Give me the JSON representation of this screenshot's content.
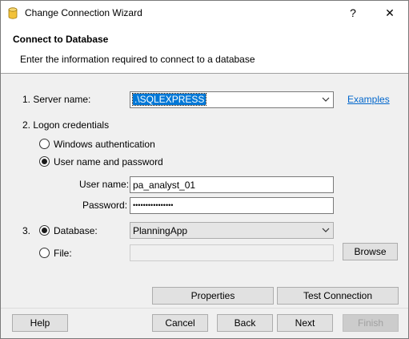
{
  "window": {
    "title": "Change Connection Wizard",
    "help_glyph": "?",
    "close_glyph": "✕"
  },
  "header": {
    "title": "Connect to Database",
    "subtitle": "Enter the information required to connect to a database"
  },
  "form": {
    "server_label": "1. Server name:",
    "server_value": ".\\SQLEXPRESS",
    "examples_link": "Examples",
    "logon_label": "2. Logon credentials",
    "windows_auth_label": "Windows authentication",
    "userpass_label": "User name and password",
    "username_label": "User name:",
    "username_value": "pa_analyst_01",
    "password_label": "Password:",
    "password_value": "••••••••••••••••",
    "step3_label": "3.",
    "database_label": "Database:",
    "database_value": "PlanningApp",
    "file_label": "File:",
    "file_value": "",
    "browse_label": "Browse",
    "auth_selected": "userpass",
    "source_selected": "database"
  },
  "actions": {
    "properties_label": "Properties",
    "test_connection_label": "Test Connection"
  },
  "footer": {
    "help_label": "Help",
    "cancel_label": "Cancel",
    "back_label": "Back",
    "next_label": "Next",
    "finish_label": "Finish"
  }
}
